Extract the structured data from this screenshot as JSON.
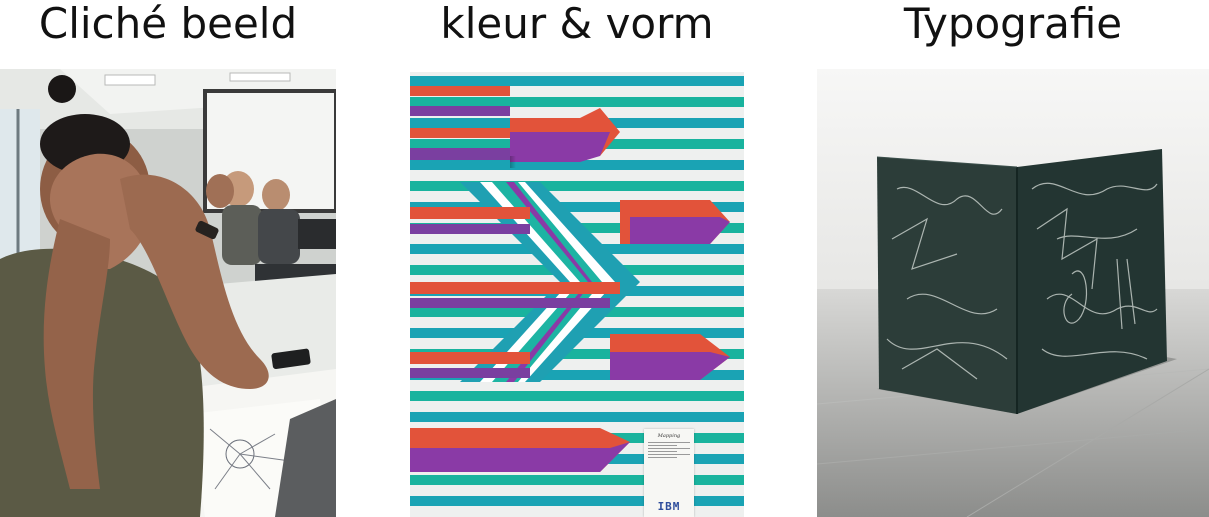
{
  "panels": [
    {
      "title": "Cliché beeld"
    },
    {
      "title": "kleur & vorm",
      "poster": {
        "label_title": "Mapping",
        "brand": "IBM"
      }
    },
    {
      "title": "Typografie"
    }
  ]
}
